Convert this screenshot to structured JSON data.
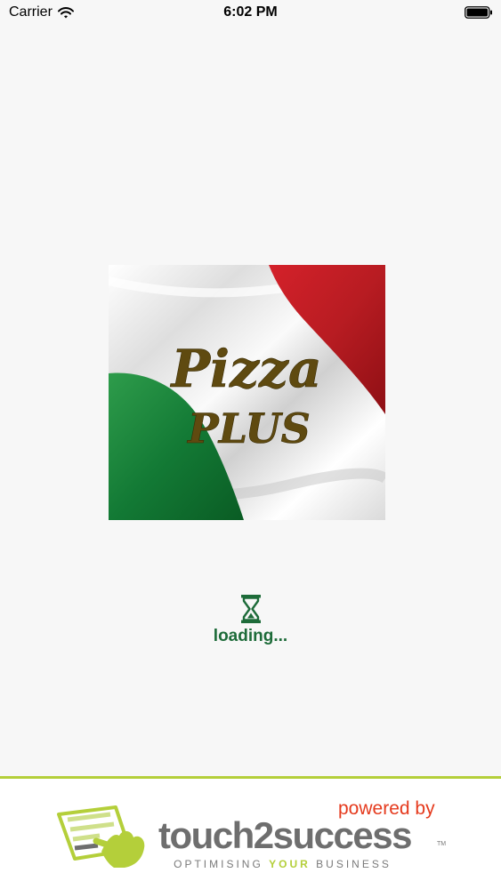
{
  "status_bar": {
    "carrier": "Carrier",
    "time": "6:02 PM"
  },
  "splash": {
    "logo_line1": "Pizza",
    "logo_line2": "PLUS",
    "loading_text": "loading..."
  },
  "footer": {
    "powered_by": "powered by",
    "brand_name": "touch2success",
    "trademark": "TM",
    "tagline_before": "OPTIMISING",
    "tagline_accent": "YOUR",
    "tagline_after": "BUSINESS"
  },
  "colors": {
    "background": "#f7f7f7",
    "loading_green": "#1d6b39",
    "brand_lime": "#b4cf3a",
    "powered_red": "#e53a1d",
    "brand_grey": "#6e6e6e"
  }
}
